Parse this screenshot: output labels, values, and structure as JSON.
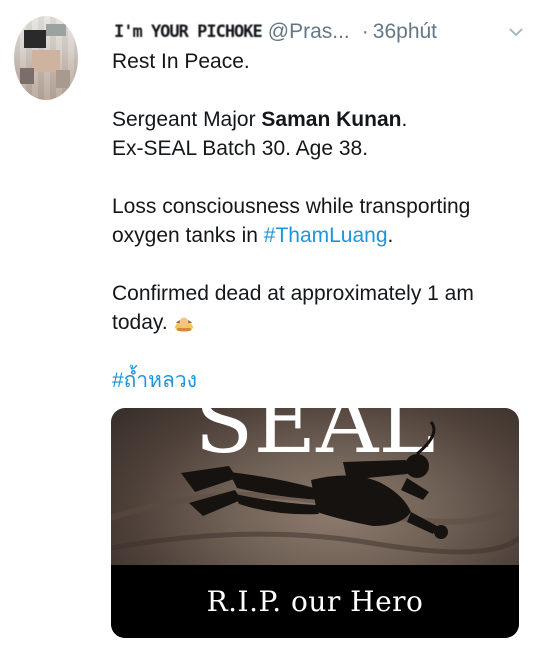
{
  "tweet": {
    "display_name": "I'm YOUR PICHOKE",
    "handle": "@Pras...",
    "separator": "·",
    "time": "36phút",
    "menu_icon": "chevron-down-icon",
    "lines": {
      "l1": "Rest In Peace.",
      "l2_prefix": "Sergeant Major ",
      "l2_bold": "Saman Kunan",
      "l2_suffix": ".",
      "l3": "Ex-SEAL Batch 30. Age 38.",
      "l4": "Loss consciousness while transporting",
      "l5_prefix": "oxygen tanks in ",
      "l5_hashtag": "#ThamLuang",
      "l5_suffix": ".",
      "l6": "Confirmed dead at approximately 1 am",
      "l7": "today.",
      "emoji_icon": "bowing-person-icon",
      "l8_hashtag": "#ถ้ำหลวง"
    },
    "media": {
      "top_text": "SEAL",
      "caption": "R.I.P. our Hero",
      "icon": "diver-silhouette-icon"
    }
  },
  "colors": {
    "text": "#14171a",
    "secondary": "#657786",
    "link": "#1b95e0",
    "banner": "#000000"
  }
}
